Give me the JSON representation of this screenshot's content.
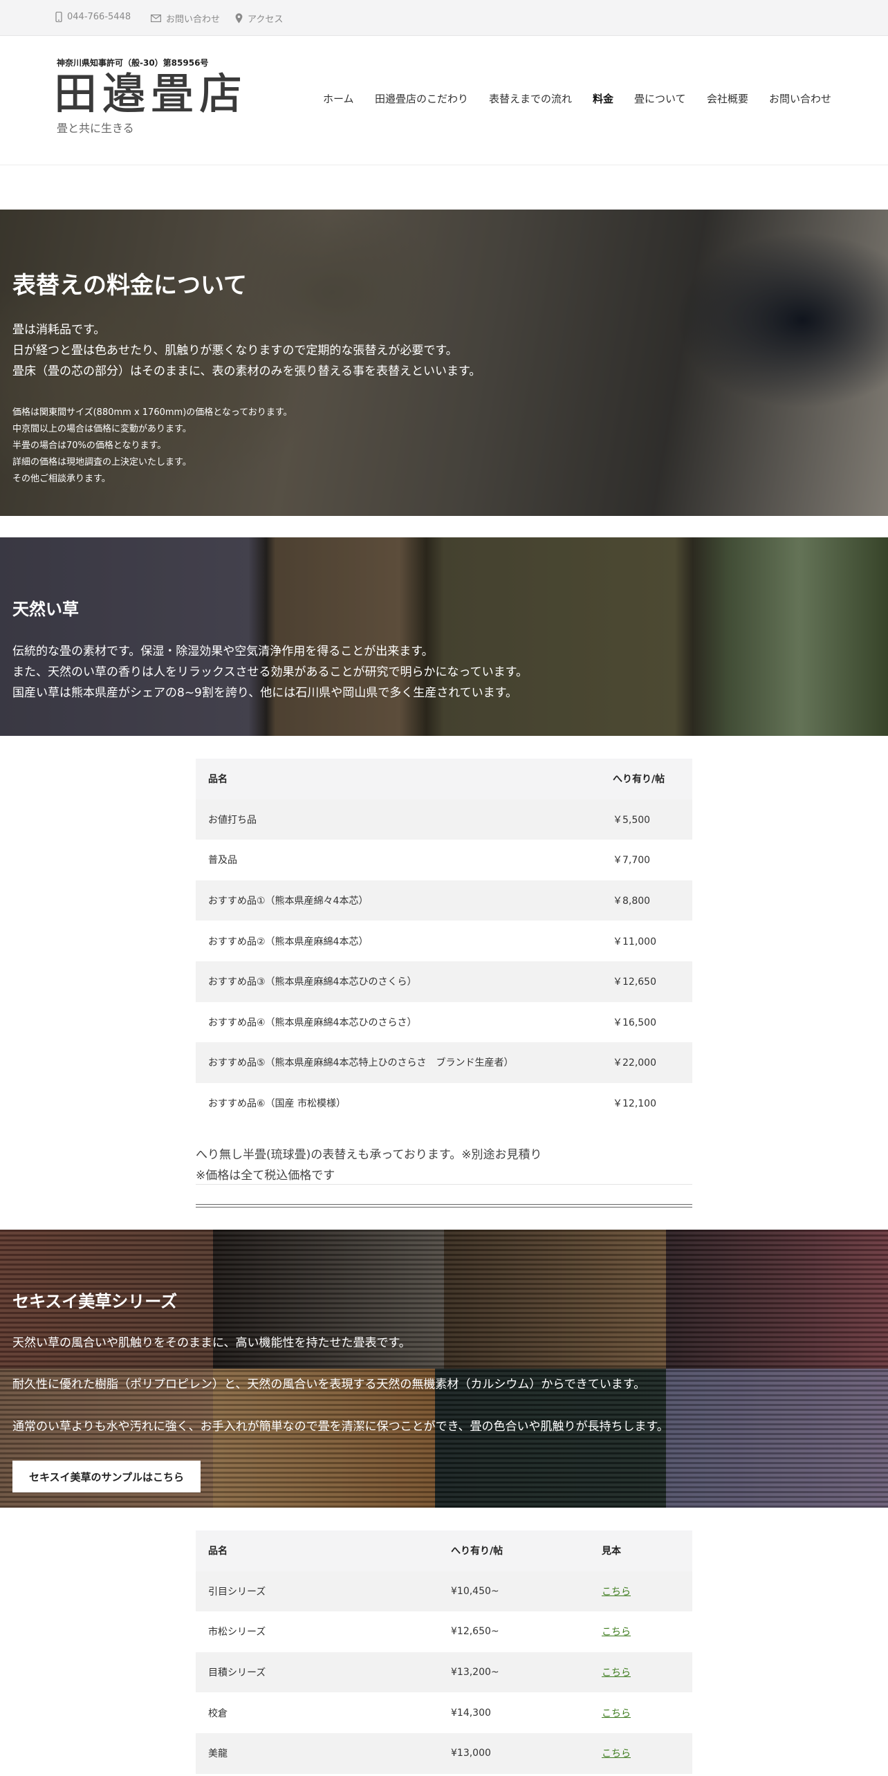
{
  "topbar": {
    "phone": "044-766-5448",
    "contact": "お問い合わせ",
    "access": "アクセス",
    "icons": [
      "phone-icon",
      "mail-icon",
      "map-pin-icon"
    ]
  },
  "header": {
    "license": "神奈川県知事許可（般-30）第85956号",
    "logo": "田邉畳店",
    "tagline": "畳と共に生きる"
  },
  "nav": {
    "items": [
      "ホーム",
      "田邉畳店のこだわり",
      "表替えまでの流れ",
      "料金",
      "畳について",
      "会社概要",
      "お問い合わせ"
    ],
    "active": "料金"
  },
  "hero1": {
    "title": "表替えの料金について",
    "body": [
      "畳は消耗品です。",
      "日が経つと畳は色あせたり、肌触りが悪くなりますので定期的な張替えが必要です。",
      "畳床（畳の芯の部分）はそのままに、表の素材のみを張り替える事を表替えといいます。"
    ],
    "notes": [
      "価格は関東間サイズ(880mm x 1760mm)の価格となっております。",
      "中京間以上の場合は価格に変動があります。",
      "半畳の場合は70%の価格となります。",
      "詳細の価格は現地調査の上決定いたします。",
      "その他ご相談承ります。"
    ]
  },
  "hero2": {
    "title": "天然い草",
    "body": [
      "伝統的な畳の素材です。保湿・除湿効果や空気清浄作用を得ることが出来ます。",
      "また、天然のい草の香りは人をリラックスさせる効果があることが研究で明らかになっています。",
      "国産い草は熊本県産がシェアの8~9割を誇り、他には石川県や岡山県で多く生産されています。"
    ]
  },
  "table1": {
    "headers": [
      "品名",
      "へり有り/帖"
    ],
    "rows": [
      [
        "お値打ち品",
        "￥5,500"
      ],
      [
        "普及品",
        "￥7,700"
      ],
      [
        "おすすめ品①（熊本県産綿々4本芯）",
        "￥8,800"
      ],
      [
        "おすすめ品②（熊本県産麻綿4本芯）",
        "￥11,000"
      ],
      [
        "おすすめ品③（熊本県産麻綿4本芯ひのさくら）",
        "￥12,650"
      ],
      [
        "おすすめ品④（熊本県産麻綿4本芯ひのさらさ）",
        "￥16,500"
      ],
      [
        "おすすめ品⑤（熊本県産麻綿4本芯特上ひのさらさ　ブランド生産者）",
        "￥22,000"
      ],
      [
        "おすすめ品⑥（国産 市松模様）",
        "￥12,100"
      ]
    ],
    "notes": [
      "へり無し半畳(琉球畳)の表替えも承っております。※別途お見積り",
      "※価格は全て税込価格です"
    ]
  },
  "hero3": {
    "title": "セキスイ美草シリーズ",
    "body": [
      "天然い草の風合いや肌触りをそのままに、高い機能性を持たせた畳表です。",
      "耐久性に優れた樹脂（ポリプロピレン）と、天然の風合いを表現する天然の無機素材（カルシウム）からできています。",
      "通常のい草よりも水や汚れに強く、お手入れが簡単なので畳を清潔に保つことができ、畳の色合いや肌触りが長持ちします。"
    ],
    "button": "セキスイ美草のサンプルはこちら"
  },
  "table2": {
    "headers": [
      "品名",
      "へり有り/帖",
      "見本"
    ],
    "rows": [
      [
        "引目シリーズ",
        "¥10,450~",
        "こちら"
      ],
      [
        "市松シリーズ",
        "¥12,650~",
        "こちら"
      ],
      [
        "目積シリーズ",
        "¥13,200~",
        "こちら"
      ],
      [
        "校倉",
        "¥14,300",
        "こちら"
      ],
      [
        "美龍",
        "¥13,000",
        "こちら"
      ]
    ]
  }
}
